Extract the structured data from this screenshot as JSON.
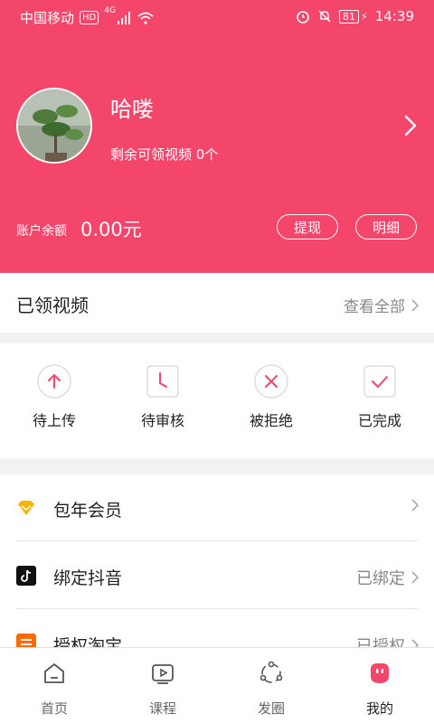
{
  "status_bar": {
    "carrier": "中国移动",
    "hd": "HD",
    "network": "4G",
    "battery": "81",
    "time": "14:39"
  },
  "profile": {
    "username": "哈喽",
    "remaining_text": "剩余可领视频 0个",
    "balance_label": "账户余额",
    "balance_value": "0.00元",
    "withdraw_label": "提现",
    "detail_label": "明细"
  },
  "claimed": {
    "title": "已领视频",
    "view_all": "查看全部"
  },
  "statuses": [
    {
      "label": "待上传",
      "icon": "upload-icon"
    },
    {
      "label": "待审核",
      "icon": "clock-icon"
    },
    {
      "label": "被拒绝",
      "icon": "close-icon"
    },
    {
      "label": "已完成",
      "icon": "check-icon"
    }
  ],
  "list": [
    {
      "label": "包年会员",
      "value": "",
      "icon": "diamond-icon"
    },
    {
      "label": "绑定抖音",
      "value": "已绑定",
      "icon": "tiktok-icon"
    },
    {
      "label": "授权淘宝",
      "value": "已授权",
      "icon": "taobao-icon"
    }
  ],
  "tabs": [
    {
      "label": "首页",
      "icon": "home-icon"
    },
    {
      "label": "课程",
      "icon": "video-icon"
    },
    {
      "label": "发圈",
      "icon": "share-circle-icon"
    },
    {
      "label": "我的",
      "icon": "profile-icon"
    }
  ],
  "colors": {
    "accent": "#f4456b",
    "diamond": "#f5b400"
  }
}
